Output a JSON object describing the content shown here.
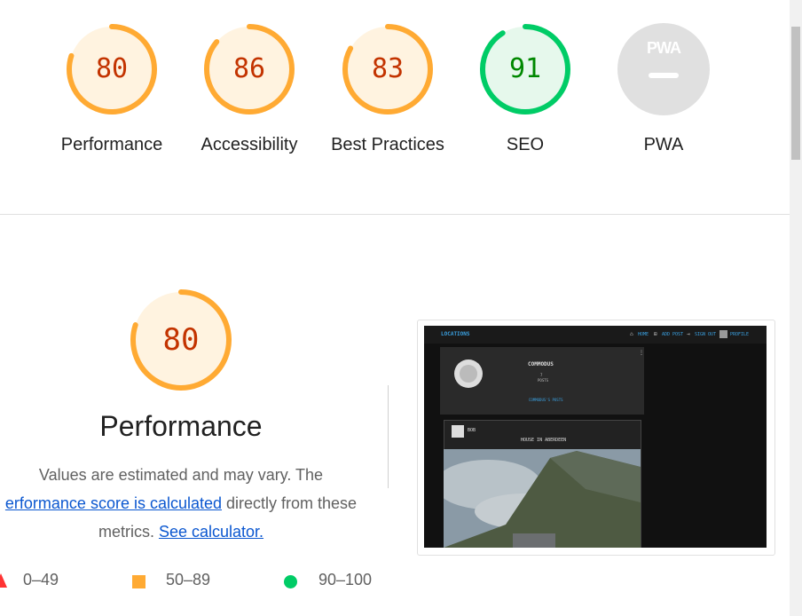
{
  "categories": [
    {
      "label": "Performance",
      "score": 80,
      "color": "#fa3",
      "text_color": "#c33300",
      "bg": "#fff3e0"
    },
    {
      "label": "Accessibility",
      "score": 86,
      "color": "#fa3",
      "text_color": "#c33300",
      "bg": "#fff3e0"
    },
    {
      "label": "Best Practices",
      "score": 83,
      "color": "#fa3",
      "text_color": "#c33300",
      "bg": "#fff3e0"
    },
    {
      "label": "SEO",
      "score": 91,
      "color": "#0c6",
      "text_color": "#008800",
      "bg": "#e6f8ec"
    }
  ],
  "pwa": {
    "label": "PWA",
    "badge_text": "PWA"
  },
  "performance": {
    "score": 80,
    "title": "Performance",
    "desc_1": "Values are estimated and may vary. The",
    "link_1": "erformance score is calculated",
    "desc_2": " directly from these",
    "desc_3": "metrics. ",
    "link_2": "See calculator."
  },
  "legend": {
    "fail": "0–49",
    "average": "50–89",
    "pass": "90–100"
  },
  "screenshot": {
    "brand": "LOCATIONS",
    "nav": [
      "HOME",
      "ADD POST",
      "SIGN OUT",
      "PROFILE"
    ],
    "username": "COMMODUS",
    "posts_count": "7",
    "posts_label": "POSTS",
    "link": "COMMODUS'S POSTS",
    "post_author": "BOB",
    "post_title": "HOUSE IN ABERDEEN"
  }
}
